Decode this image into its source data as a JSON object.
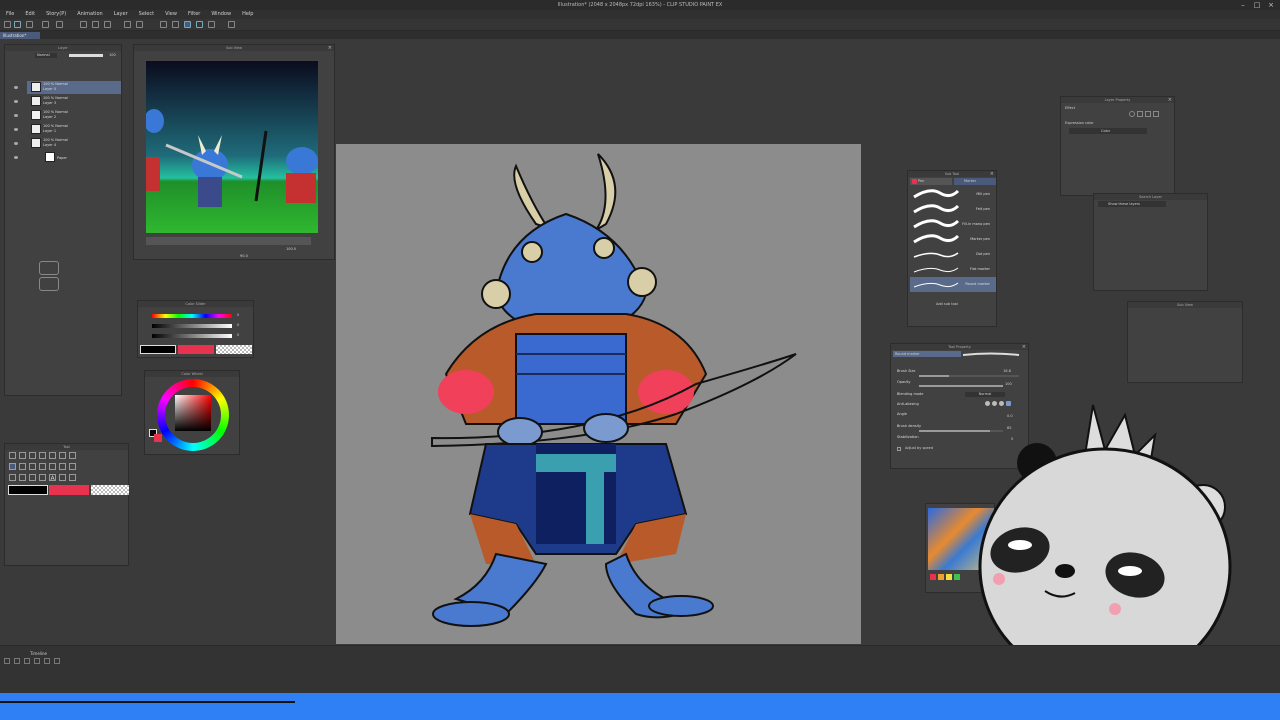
{
  "window": {
    "title": "Illustration* (2048 x 2048px 72dpi 163%) - CLIP STUDIO PAINT EX",
    "tab_label": "Illustration*"
  },
  "menu": [
    "File",
    "Edit",
    "Story(P)",
    "Animation",
    "Layer",
    "Select",
    "View",
    "Filter",
    "Window",
    "Help"
  ],
  "layer_panel": {
    "title": "Layer",
    "blend_mode": "Normal",
    "opacity": "100",
    "layers": [
      {
        "meta": "100 % Normal",
        "name": "Layer 5"
      },
      {
        "meta": "100 % Normal",
        "name": "Layer 3"
      },
      {
        "meta": "100 % Normal",
        "name": "Layer 2"
      },
      {
        "meta": "100 % Normal",
        "name": "Layer 1"
      },
      {
        "meta": "100 % Normal",
        "name": "Layer 4"
      },
      {
        "meta": "",
        "name": "Paper"
      }
    ]
  },
  "sub_view": {
    "title": "Sub View",
    "zoom": "100.0",
    "angle": "90.0"
  },
  "color_slider": {
    "title": "Color Slider",
    "values": [
      "0",
      "0",
      "0"
    ]
  },
  "color_wheel": {
    "title": "Color Wheel"
  },
  "tool_panel": {
    "title": "Tool"
  },
  "sub_tool": {
    "title": "Sub Tool",
    "tabs": [
      "Pen",
      "Marker"
    ],
    "brushes": [
      "Mill pen",
      "Felt pen",
      "Fill-in mono pen",
      "Marker pen",
      "Dot pen",
      "Flat marker",
      "Round marker"
    ],
    "selected_index": 6,
    "add_label": "Add sub tool"
  },
  "tool_property": {
    "title": "Tool Property",
    "header": "Round marker",
    "rows": [
      {
        "label": "Brush Size",
        "value": "16.8"
      },
      {
        "label": "Opacity",
        "value": "100"
      },
      {
        "label": "Blending mode",
        "value": "Normal"
      },
      {
        "label": "Anti-aliasing",
        "value": ""
      },
      {
        "label": "Angle",
        "value": "0.0"
      },
      {
        "label": "Brush density",
        "value": "85"
      },
      {
        "label": "Stabilization",
        "value": "5"
      }
    ],
    "adjust_label": "Adjust by speed",
    "brush_size_level": 0.3,
    "opacity_level": 1.0,
    "density_level": 0.85
  },
  "layer_property": {
    "title": "Layer Property",
    "effect_label": "Effect",
    "expression_label": "Expression color",
    "expression_value": "Color"
  },
  "search_layer": {
    "title": "Search Layer",
    "value": "Show these layers"
  },
  "navigator_small": {
    "title": "Sub View"
  },
  "timeline": {
    "title": "Timeline"
  },
  "colors": {
    "main_color": "#000000",
    "sub_color": "#e8334f",
    "accent_blue": "#2f7ff5",
    "selected_layer": "#5a6a8a"
  }
}
